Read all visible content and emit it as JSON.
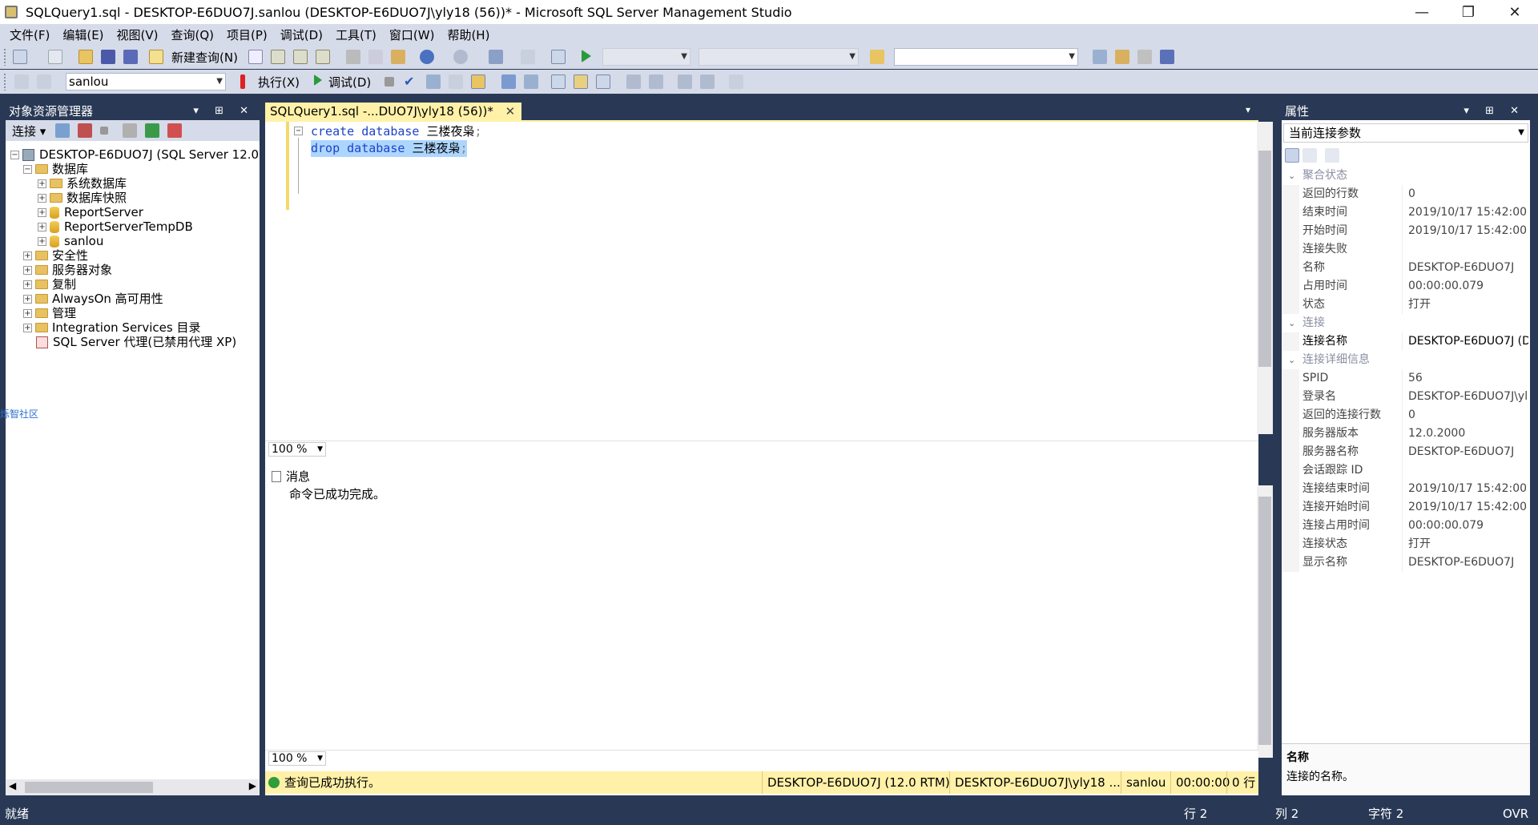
{
  "window": {
    "title": "SQLQuery1.sql - DESKTOP-E6DUO7J.sanlou (DESKTOP-E6DUO7J\\yly18 (56))* - Microsoft SQL Server Management Studio",
    "minimize": "—",
    "restore": "❐",
    "close": "✕"
  },
  "menu": [
    "文件(F)",
    "编辑(E)",
    "视图(V)",
    "查询(Q)",
    "项目(P)",
    "调试(D)",
    "工具(T)",
    "窗口(W)",
    "帮助(H)"
  ],
  "toolbar1": {
    "new_query_label": "新建查询(N)"
  },
  "toolbar2": {
    "database_selector": "sanlou",
    "execute_label": "执行(X)",
    "debug_label": "调试(D)"
  },
  "object_explorer": {
    "title": "对象资源管理器",
    "pin": "▾ ⊞ ✕",
    "connect_label": "连接 ▾",
    "server": "DESKTOP-E6DUO7J (SQL Server 12.0.",
    "nodes": [
      {
        "label": "数据库",
        "expander": "⊟"
      },
      {
        "label": "系统数据库",
        "expander": "⊞"
      },
      {
        "label": "数据库快照",
        "expander": "⊞"
      },
      {
        "label": "ReportServer",
        "expander": "⊞"
      },
      {
        "label": "ReportServerTempDB",
        "expander": "⊞"
      },
      {
        "label": "sanlou",
        "expander": "⊞"
      },
      {
        "label": "安全性",
        "expander": "⊞"
      },
      {
        "label": "服务器对象",
        "expander": "⊞"
      },
      {
        "label": "复制",
        "expander": "⊞"
      },
      {
        "label": "AlwaysOn 高可用性",
        "expander": "⊞"
      },
      {
        "label": "管理",
        "expander": "⊞"
      },
      {
        "label": "Integration Services 目录",
        "expander": "⊞"
      },
      {
        "label": "SQL Server 代理(已禁用代理 XP)",
        "expander": ""
      }
    ],
    "side_link": "烁智社区"
  },
  "editor": {
    "tab_label": "SQLQuery1.sql -...DUO7J\\yly18 (56))*",
    "tab_close": "✕",
    "lines": [
      {
        "kw1": "create",
        "kw2": "database",
        "name": "三楼夜枭",
        "end": ";"
      },
      {
        "kw1": "drop",
        "kw2": "database",
        "name": "三楼夜枭",
        "end": ";"
      }
    ],
    "zoom": "100 %",
    "results_tab": "消息",
    "results_message": "命令已成功完成。",
    "zoom2": "100 %"
  },
  "query_status": {
    "message": "查询已成功执行。",
    "server": "DESKTOP-E6DUO7J (12.0 RTM)",
    "user": "DESKTOP-E6DUO7J\\yly18 ...",
    "database": "sanlou",
    "elapsed": "00:00:00",
    "rows": "0 行"
  },
  "properties": {
    "title": "属性",
    "pin": "▾ ⊞ ✕",
    "selector": "当前连接参数",
    "categories": [
      {
        "name": "聚合状态",
        "rows": [
          {
            "name": "返回的行数",
            "value": "0"
          },
          {
            "name": "结束时间",
            "value": "2019/10/17 15:42:00"
          },
          {
            "name": "开始时间",
            "value": "2019/10/17 15:42:00"
          },
          {
            "name": "连接失败",
            "value": ""
          },
          {
            "name": "名称",
            "value": "DESKTOP-E6DUO7J"
          },
          {
            "name": "占用时间",
            "value": "00:00:00.079"
          },
          {
            "name": "状态",
            "value": "打开"
          }
        ]
      },
      {
        "name": "连接",
        "rows": [
          {
            "name": "连接名称",
            "value": "DESKTOP-E6DUO7J (D"
          }
        ]
      },
      {
        "name": "连接详细信息",
        "rows": [
          {
            "name": "SPID",
            "value": "56"
          },
          {
            "name": "登录名",
            "value": "DESKTOP-E6DUO7J\\yl"
          },
          {
            "name": "返回的连接行数",
            "value": "0"
          },
          {
            "name": "服务器版本",
            "value": "12.0.2000"
          },
          {
            "name": "服务器名称",
            "value": "DESKTOP-E6DUO7J"
          },
          {
            "name": "会话跟踪 ID",
            "value": ""
          },
          {
            "name": "连接结束时间",
            "value": "2019/10/17 15:42:00"
          },
          {
            "name": "连接开始时间",
            "value": "2019/10/17 15:42:00"
          },
          {
            "name": "连接占用时间",
            "value": "00:00:00.079"
          },
          {
            "name": "连接状态",
            "value": "打开"
          },
          {
            "name": "显示名称",
            "value": "DESKTOP-E6DUO7J"
          }
        ]
      }
    ],
    "desc_title": "名称",
    "desc_text": "连接的名称。"
  },
  "statusbar": {
    "ready": "就绪",
    "row": "行 2",
    "col": "列 2",
    "char": "字符 2",
    "mode": "OVR"
  },
  "colors": {
    "chrome": "#293955",
    "toolbar": "#d6dbe9",
    "tab_active": "#fff1a8",
    "keyword": "#1e42c8",
    "selection": "#add6ff"
  }
}
